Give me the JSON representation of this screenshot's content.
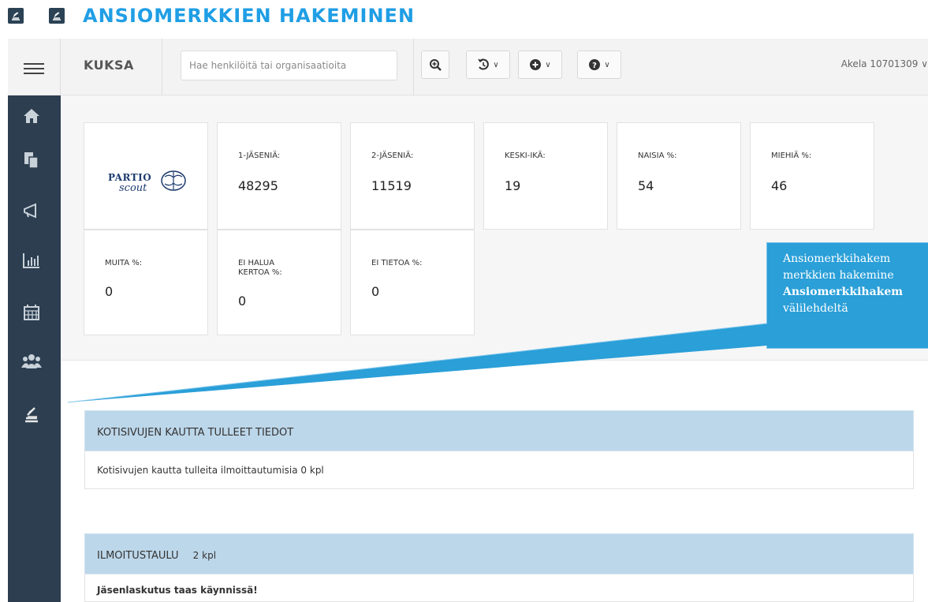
{
  "doc": {
    "title": "ANSIOMERKKIEN HAKEMINEN"
  },
  "header": {
    "brand": "KUKSA",
    "search_placeholder": "Hae henkilöitä tai organisaatioita",
    "user": "Akela 10701309 ∨"
  },
  "stats": {
    "logo": {
      "line1": "PARTIO",
      "line2": "scout"
    },
    "cards": [
      {
        "label": "1-JÄSENIÄ:",
        "value": "48295"
      },
      {
        "label": "2-JÄSENIÄ:",
        "value": "11519"
      },
      {
        "label": "KESKI-IKÄ:",
        "value": "19"
      },
      {
        "label": "NAISIA %:",
        "value": "54"
      },
      {
        "label": "MIEHIÄ %:",
        "value": "46"
      },
      {
        "label": "MUITA %:",
        "value": "0"
      },
      {
        "label": "EI HALUA KERTOA %:",
        "value": "0"
      },
      {
        "label": "EI TIETOA %:",
        "value": "0"
      }
    ]
  },
  "callout": {
    "line1": "Ansiomerkkihakem",
    "line2": "merkkien hakemine",
    "line3": "Ansiomerkkihakem",
    "line4": "välilehdeltä"
  },
  "panels": {
    "kotisivut": {
      "title": "KOTISIVUJEN KAUTTA TULLEET TIEDOT",
      "body": "Kotisivujen kautta tulleita ilmoittautumisia 0 kpl"
    },
    "ilmoitustaulu": {
      "title": "ILMOITUSTAULU",
      "count": "2 kpl",
      "item": "Jäsenlaskutus taas käynnissä!"
    }
  },
  "colors": {
    "accent": "#1f9ee5",
    "sidebar": "#2c3e50",
    "panel_head": "#bdd7ea",
    "callout": "#2a9fd8"
  },
  "icons": [
    "menu-icon",
    "home-icon",
    "documents-icon",
    "megaphone-icon",
    "bar-chart-icon",
    "calendar-icon",
    "users-icon",
    "badge-application-icon",
    "zoom-in-icon",
    "history-icon",
    "add-icon",
    "help-icon"
  ]
}
